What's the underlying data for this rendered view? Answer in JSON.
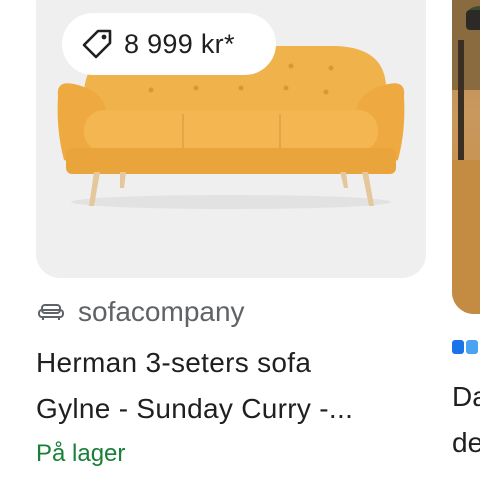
{
  "current_card": {
    "price_badge": {
      "icon": "price-tag-icon",
      "price": "8 999 kr*"
    },
    "product_image": {
      "subject": "sofa",
      "color": "#f0b24a"
    },
    "source": {
      "icon": "sofa-icon",
      "name": "sofacompany"
    },
    "title_line1": "Herman 3-seters sofa",
    "title_line2": "Gylne - Sunday Curry -...",
    "availability": "På lager"
  },
  "next_card": {
    "title_line1": "Da",
    "title_line2": "de"
  },
  "colors": {
    "availability_green": "#188038",
    "store_grey": "#5f6368",
    "logo_blue": "#1a73e8"
  }
}
